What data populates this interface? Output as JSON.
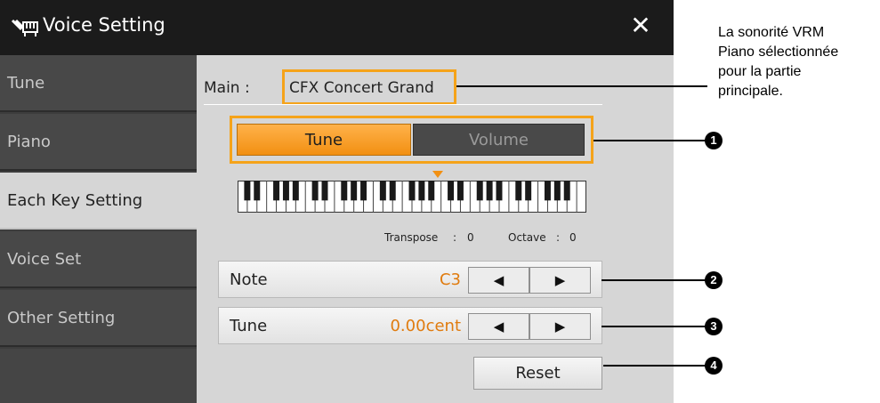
{
  "window": {
    "title": "Voice Setting",
    "close_glyph": "✕",
    "icon": "piano-keys-icon"
  },
  "sidebar": {
    "items": [
      {
        "label": "Tune"
      },
      {
        "label": "Piano"
      },
      {
        "label": "Each Key Setting",
        "selected": true
      },
      {
        "label": "Voice Set"
      },
      {
        "label": "Other Setting"
      }
    ]
  },
  "main": {
    "main_label": "Main :",
    "main_value": "CFX Concert Grand",
    "tabs": [
      {
        "label": "Tune",
        "active": true
      },
      {
        "label": "Volume",
        "active": false
      }
    ],
    "transpose_label": "Transpose",
    "transpose_sep": ":",
    "transpose_value": "0",
    "octave_label": "Octave",
    "octave_sep": ":",
    "octave_value": "0",
    "note_row": {
      "label": "Note",
      "value": "C3",
      "left_arrow": "◀",
      "right_arrow": "▶"
    },
    "tune_row": {
      "label": "Tune",
      "value": "0.00cent",
      "left_arrow": "◀",
      "right_arrow": "▶"
    },
    "reset_label": "Reset"
  },
  "callouts": {
    "caption_lines": [
      "La sonorité VRM",
      "Piano sélectionnée",
      "pour la partie",
      "principale."
    ],
    "numbers": [
      "1",
      "2",
      "3",
      "4"
    ]
  },
  "colors": {
    "accent_orange": "#f29012",
    "highlight_box": "#f5a31a",
    "value_orange": "#e07b0e",
    "titlebar": "#1b1b1b",
    "sidebar": "#484848",
    "panel": "#d6d6d6"
  }
}
